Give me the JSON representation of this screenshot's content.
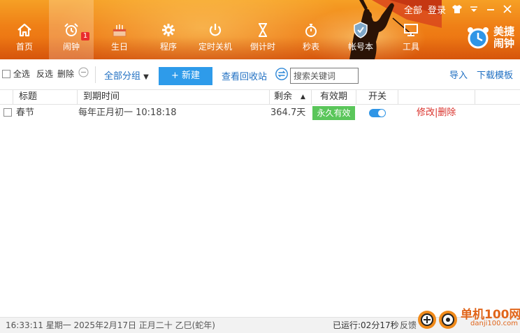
{
  "header": {
    "nav": [
      {
        "label": "首页",
        "icon": "home-icon"
      },
      {
        "label": "闹钟",
        "icon": "alarm-clock-icon",
        "badge": "1",
        "active": true
      },
      {
        "label": "生日",
        "icon": "cake-icon"
      },
      {
        "label": "程序",
        "icon": "gear-icon"
      },
      {
        "label": "定时关机",
        "icon": "power-icon"
      },
      {
        "label": "倒计时",
        "icon": "hourglass-icon"
      },
      {
        "label": "秒表",
        "icon": "stopwatch-icon"
      },
      {
        "label": "帐号本",
        "icon": "shield-icon"
      },
      {
        "label": "工具",
        "icon": "monitor-icon"
      }
    ],
    "top_links": {
      "all": "全部",
      "login": "登录"
    },
    "brand": {
      "line1": "美捷",
      "line2": "闹钟"
    }
  },
  "toolbar": {
    "select_all": "全选",
    "invert": "反选",
    "delete": "删除",
    "group_dropdown": "全部分组",
    "new_button": "+ 新建",
    "recycle_bin": "查看回收站",
    "search_placeholder": "搜索关键词",
    "import": "导入",
    "download_template": "下载模板"
  },
  "table": {
    "columns": [
      "标题",
      "到期时间",
      "剩余",
      "有效期",
      "开关"
    ],
    "rows": [
      {
        "title": "春节",
        "due": "每年正月初一 10:18:18",
        "remaining": "364.7天",
        "validity": "永久有效",
        "enabled": true,
        "edit": "修改",
        "delete": "删除"
      }
    ]
  },
  "status": {
    "datetime": "16:33:11 星期一 2025年2月17日 正月二十 乙巳(蛇年)",
    "running": "已运行:02分17秒",
    "feedback": "反馈"
  },
  "watermark": {
    "site": "单机100网",
    "url": "danji100.com"
  },
  "colors": {
    "header_orange": "#ef7f16",
    "accent_blue": "#2e9bea",
    "valid_green": "#5ac65a",
    "action_red": "#d9302a",
    "badge_red": "#ea2d2d"
  }
}
